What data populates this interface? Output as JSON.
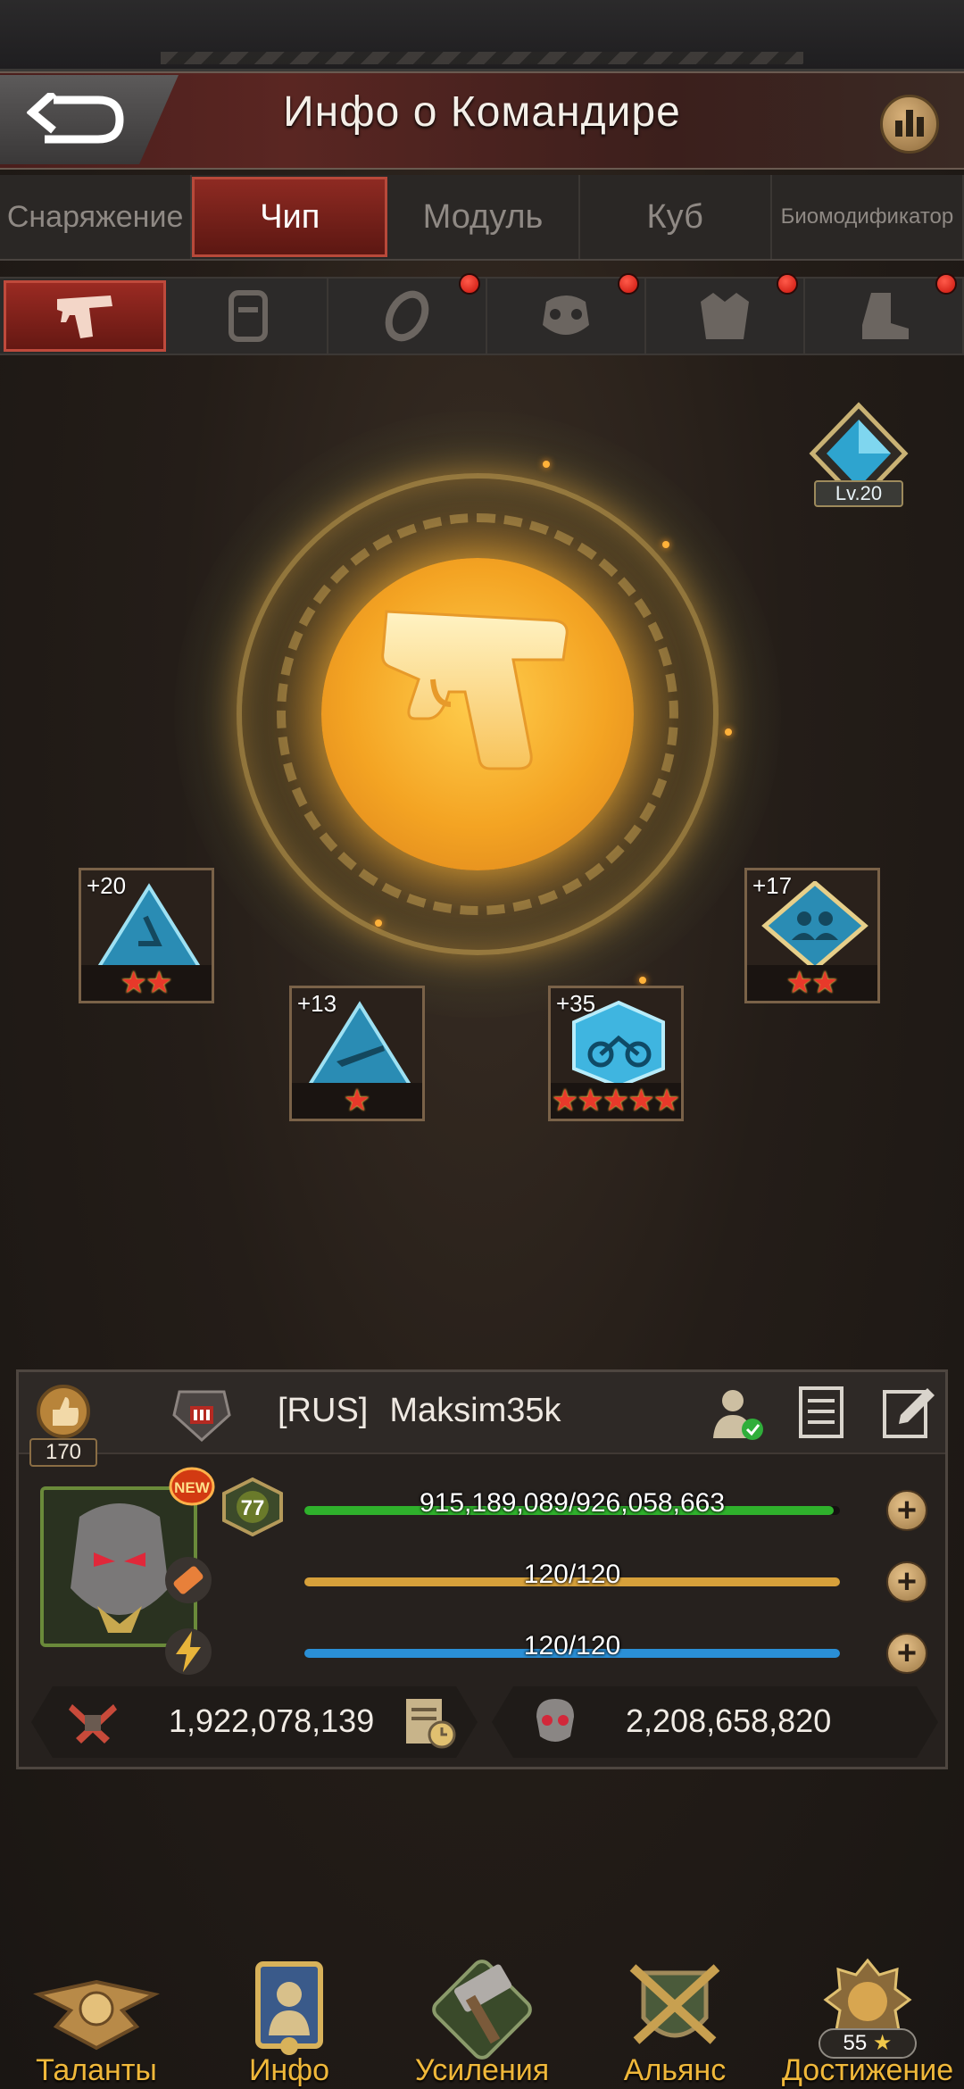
{
  "header": {
    "title": "Инфо о Командире"
  },
  "main_tabs": [
    {
      "label": "Снаряжение",
      "active": false
    },
    {
      "label": "Чип",
      "active": true
    },
    {
      "label": "Модуль",
      "active": false
    },
    {
      "label": "Куб",
      "active": false
    },
    {
      "label": "Биомодификатор",
      "active": false
    }
  ],
  "sub_tabs": [
    {
      "icon": "pistol-icon",
      "active": true,
      "alert": false
    },
    {
      "icon": "armor-plate-icon",
      "active": false,
      "alert": false
    },
    {
      "icon": "ring-icon",
      "active": false,
      "alert": true
    },
    {
      "icon": "gas-mask-icon",
      "active": false,
      "alert": true
    },
    {
      "icon": "vest-icon",
      "active": false,
      "alert": true
    },
    {
      "icon": "boot-icon",
      "active": false,
      "alert": true
    }
  ],
  "chip_level_badge": "Lv.20",
  "chips": [
    {
      "level": "+20",
      "stars": 2,
      "icon": "blue-triangle-chip-icon"
    },
    {
      "level": "+13",
      "stars": 1,
      "icon": "blue-triangle-rifle-chip-icon"
    },
    {
      "level": "+35",
      "stars": 5,
      "icon": "motorcycle-chip-icon"
    },
    {
      "level": "+17",
      "stars": 2,
      "icon": "squad-diamond-chip-icon"
    }
  ],
  "player": {
    "likes": "170",
    "tag": "[RUS]",
    "name": "Maksim35k",
    "level": "77",
    "new_badge": "NEW",
    "exp": {
      "text": "915,189,089/926,058,663",
      "fraction": 0.988,
      "color": "#2fb12c"
    },
    "stamina": {
      "text": "120/120",
      "fraction": 1.0,
      "color": "#d6a03a"
    },
    "energy": {
      "text": "120/120",
      "fraction": 1.0,
      "color": "#2a8fd6"
    },
    "power": "1,922,078,139",
    "kills": "2,208,658,820"
  },
  "bottom_nav": [
    {
      "label": "Таланты",
      "icon": "wings-emblem-icon"
    },
    {
      "label": "Инфо",
      "icon": "commander-portrait-icon"
    },
    {
      "label": "Усиления",
      "icon": "hammer-icon"
    },
    {
      "label": "Альянс",
      "icon": "crossed-swords-shield-icon"
    },
    {
      "label": "Достижение",
      "icon": "lion-crest-icon",
      "count": "55"
    }
  ]
}
